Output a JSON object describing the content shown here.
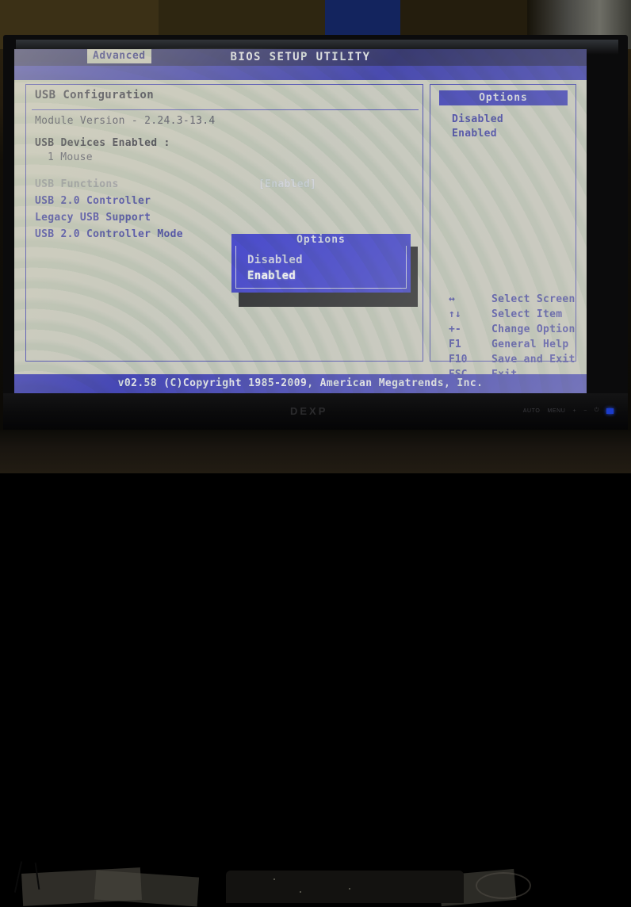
{
  "bios": {
    "title": "BIOS SETUP UTILITY",
    "active_tab": "Advanced",
    "section_title": "USB Configuration",
    "module_version": "Module Version - 2.24.3-13.4",
    "devices_header": "USB Devices Enabled :",
    "devices_items": [
      "1 Mouse"
    ],
    "settings": [
      {
        "label": "USB Functions",
        "value": "[Enabled]"
      },
      {
        "label": "USB 2.0 Controller",
        "value": ""
      },
      {
        "label": "Legacy USB Support",
        "value": ""
      },
      {
        "label": "USB 2.0 Controller Mode",
        "value": ""
      }
    ],
    "options_panel": {
      "header": "Options",
      "choices": [
        "Disabled",
        "Enabled"
      ]
    },
    "nav_keys": [
      {
        "key": "↔",
        "desc": "Select Screen"
      },
      {
        "key": "↑↓",
        "desc": "Select Item"
      },
      {
        "key": "+-",
        "desc": "Change Option"
      },
      {
        "key": "F1",
        "desc": "General Help"
      },
      {
        "key": "F10",
        "desc": "Save and Exit"
      },
      {
        "key": "ESC",
        "desc": "Exit"
      }
    ],
    "footer": "v02.58 (C)Copyright 1985-2009, American Megatrends, Inc."
  },
  "popup": {
    "title": "Options",
    "items": [
      "Disabled",
      "Enabled"
    ],
    "selected_index": 1
  },
  "monitor": {
    "brand": "DEXP",
    "osd_buttons": [
      "AUTO",
      "MENU",
      "+",
      "−",
      "⏻"
    ]
  },
  "colors": {
    "bios_blue": "#2222b4",
    "title_bar": "#0b0b58",
    "screen_bg": "#c9c9bd",
    "popup_bg": "#2323cd",
    "led": "#1b3ccc"
  }
}
